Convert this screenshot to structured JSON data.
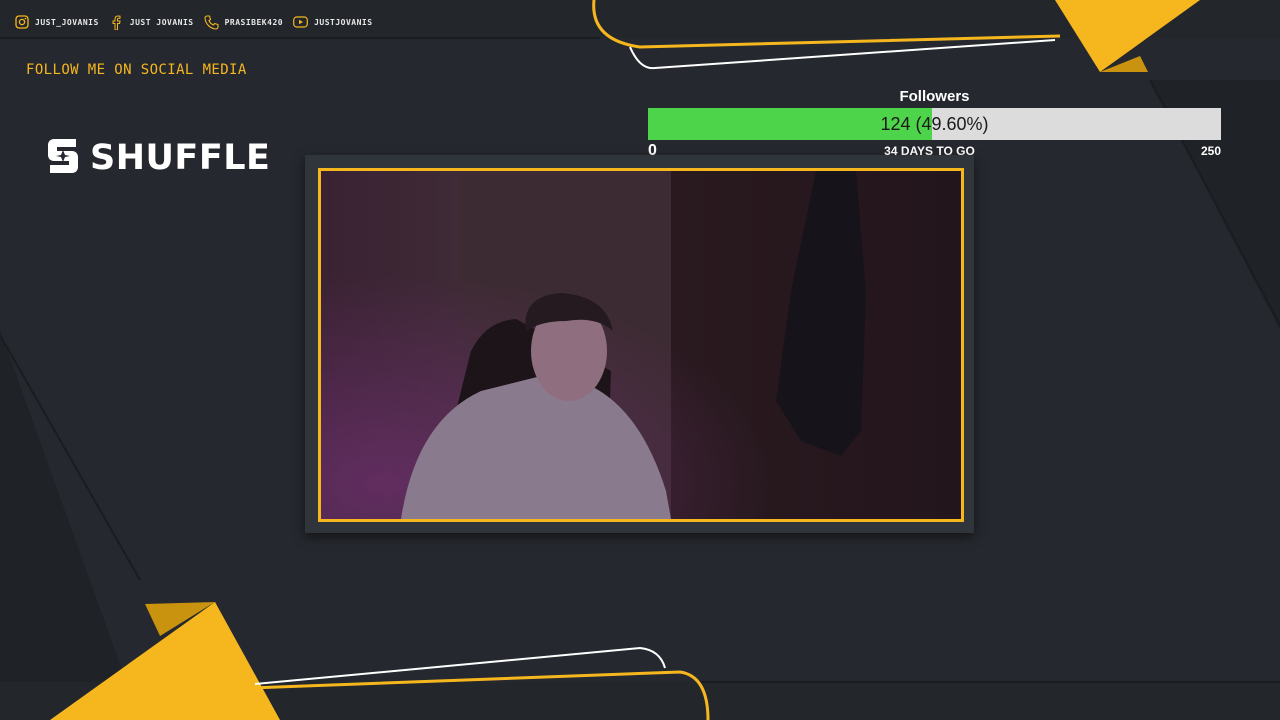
{
  "socials": [
    {
      "icon": "instagram-icon",
      "handle": "JUST_JOVANIS"
    },
    {
      "icon": "facebook-icon",
      "handle": "JUST JOVANIS"
    },
    {
      "icon": "phone-icon",
      "handle": "PRASIBEK420"
    },
    {
      "icon": "youtube-icon",
      "handle": "JUSTJOVANIS"
    }
  ],
  "follow_heading": "FOLLOW ME ON SOCIAL MEDIA",
  "logo": {
    "text": "SHUFFLE",
    "icon": "shuffle-logo-icon"
  },
  "follower_goal": {
    "title": "Followers",
    "current": 124,
    "target": 250,
    "percent": 49.6,
    "label": "124 (49.60%)",
    "min_label": "0",
    "max_label": "250",
    "days_label": "34 DAYS TO GO"
  },
  "colors": {
    "background": "#25282e",
    "accent": "#f6b71e",
    "progress_fill": "#4ed44a",
    "progress_track": "#dcdcdc",
    "text": "#ffffff"
  }
}
